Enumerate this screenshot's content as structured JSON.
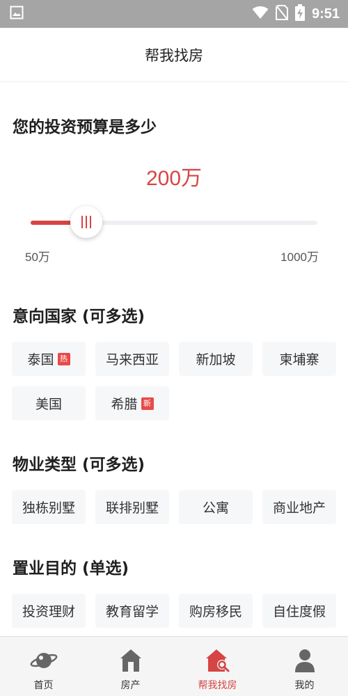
{
  "status_bar": {
    "time": "9:51"
  },
  "header": {
    "title": "帮我找房"
  },
  "budget": {
    "title": "您的投资预算是多少",
    "value_label": "200万",
    "min_label": "50万",
    "max_label": "1000万",
    "min": 50,
    "max": 1000,
    "value": 200
  },
  "countries": {
    "title": "意向国家 (可多选)",
    "items": [
      {
        "label": "泰国",
        "badge": "热"
      },
      {
        "label": "马来西亚"
      },
      {
        "label": "新加坡"
      },
      {
        "label": "柬埔寨"
      },
      {
        "label": "美国"
      },
      {
        "label": "希腊",
        "badge": "新"
      }
    ]
  },
  "property_types": {
    "title": "物业类型 (可多选)",
    "items": [
      {
        "label": "独栋别墅"
      },
      {
        "label": "联排别墅"
      },
      {
        "label": "公寓"
      },
      {
        "label": "商业地产"
      }
    ]
  },
  "purposes": {
    "title": "置业目的 (单选)",
    "items": [
      {
        "label": "投资理财"
      },
      {
        "label": "教育留学"
      },
      {
        "label": "购房移民"
      },
      {
        "label": "自住度假"
      }
    ]
  },
  "tab_bar": {
    "tabs": [
      {
        "label": "首页",
        "icon": "planet-icon"
      },
      {
        "label": "房产",
        "icon": "house-icon"
      },
      {
        "label": "帮我找房",
        "icon": "house-search-icon",
        "active": true
      },
      {
        "label": "我的",
        "icon": "person-icon"
      }
    ]
  },
  "colors": {
    "accent": "#d64545",
    "status_bar": "#a5a5a5",
    "chip_bg": "#f6f7f9"
  }
}
